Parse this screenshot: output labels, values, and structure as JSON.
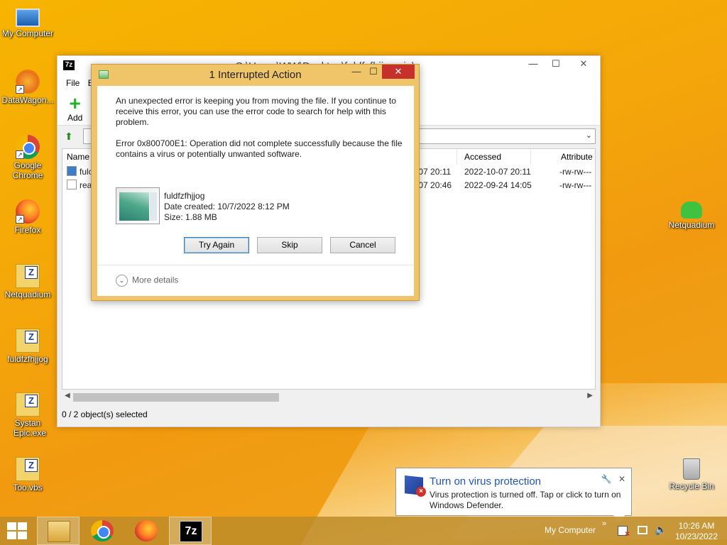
{
  "desktop": {
    "icons": [
      {
        "label": "My Computer",
        "icon": "computer-icon"
      },
      {
        "label": "DataWagon...",
        "icon": "datawagon-icon"
      },
      {
        "label": "Google Chrome",
        "icon": "chrome-icon"
      },
      {
        "label": "Firefox",
        "icon": "firefox-icon"
      },
      {
        "label": "Netquadium",
        "icon": "zip-file-icon"
      },
      {
        "label": "fuldfzfhjjog",
        "icon": "zip-file-icon"
      },
      {
        "label": "Systan Epic.exe",
        "icon": "zip-file-icon"
      },
      {
        "label": "Too.vbs",
        "icon": "zip-file-icon"
      },
      {
        "label": "Netquadium",
        "icon": "cloud-icon"
      },
      {
        "label": "Recycle Bin",
        "icon": "recycle-bin-icon"
      }
    ]
  },
  "sevenzip": {
    "app_icon": "7z",
    "title": "C:\\Users\\WW\\Desktop\\fuldfzfhjjog.zip\\",
    "menu": [
      "File",
      "E"
    ],
    "toolbar": {
      "add_label": "Add"
    },
    "columns": [
      "Name",
      "d",
      "Accessed",
      "Attribute"
    ],
    "rows": [
      {
        "name": "fulc",
        "modified": "-10-07 20:11",
        "accessed": "2022-10-07 20:11",
        "attributes": "-rw-rw---"
      },
      {
        "name": "rea",
        "modified": "-10-07 20:46",
        "accessed": "2022-09-24 14:05",
        "attributes": "-rw-rw---"
      }
    ],
    "status": "0 / 2 object(s) selected"
  },
  "dialog": {
    "title": "1 Interrupted Action",
    "message": "An unexpected error is keeping you from moving the file. If you continue to receive this error, you can use the error code to search for help with this problem.",
    "error": "Error 0x800700E1: Operation did not complete successfully because the file contains a virus or potentially unwanted software.",
    "file_name": "fuldfzfhjjog",
    "date_created": "Date created: 10/7/2022 8:12 PM",
    "size": "Size: 1.88 MB",
    "buttons": {
      "try_again": "Try Again",
      "skip": "Skip",
      "cancel": "Cancel"
    },
    "more_details": "More details"
  },
  "toast": {
    "title": "Turn on virus protection",
    "body": "Virus protection is turned off. Tap or click to turn on Windows Defender."
  },
  "taskbar": {
    "toolbar_label": "My Computer",
    "time": "10:26 AM",
    "date": "10/23/2022"
  }
}
